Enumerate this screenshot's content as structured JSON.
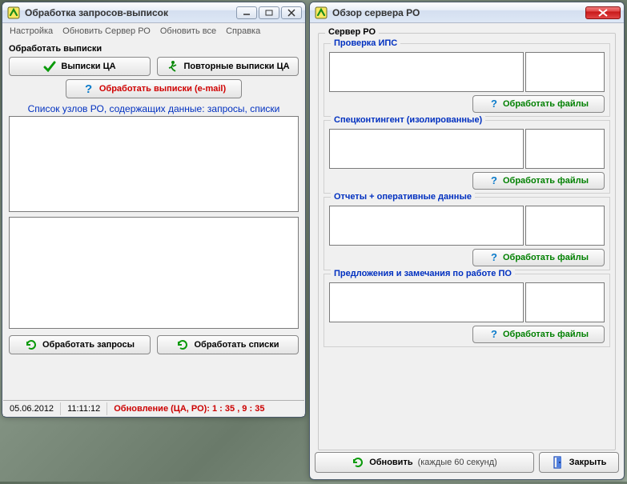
{
  "left": {
    "title": "Обработка запросов-выписок",
    "menu": [
      "Настройка",
      "Обновить Сервер РО",
      "Обновить все",
      "Справка"
    ],
    "section_label": "Обработать выписки",
    "btn_vypiski_ca": "Выписки ЦА",
    "btn_povtornye": "Повторные выписки ЦА",
    "btn_email": "Обработать выписки (e-mail)",
    "header_nodes": "Список узлов РО, содержащих данные: запросы, списки",
    "btn_process_requests": "Обработать запросы",
    "btn_process_lists": "Обработать списки",
    "status_date": "05.06.2012",
    "status_time": "11:11:12",
    "status_update": "Обновление (ЦА, РО): 1 : 35 , 9 : 35"
  },
  "right": {
    "title": "Обзор сервера РО",
    "group_label": "Сервер РО",
    "sections": [
      {
        "label": "Проверка ИПС",
        "btn": "Обработать файлы"
      },
      {
        "label": "Спецконтингент (изолированные)",
        "btn": "Обработать файлы"
      },
      {
        "label": "Отчеты + оперативные данные",
        "btn": "Обработать файлы"
      },
      {
        "label": "Предложения и замечания по работе ПО",
        "btn": "Обработать файлы"
      }
    ],
    "btn_refresh": "Обновить",
    "refresh_hint": "(каждые 60 секунд)",
    "btn_close": "Закрыть"
  }
}
